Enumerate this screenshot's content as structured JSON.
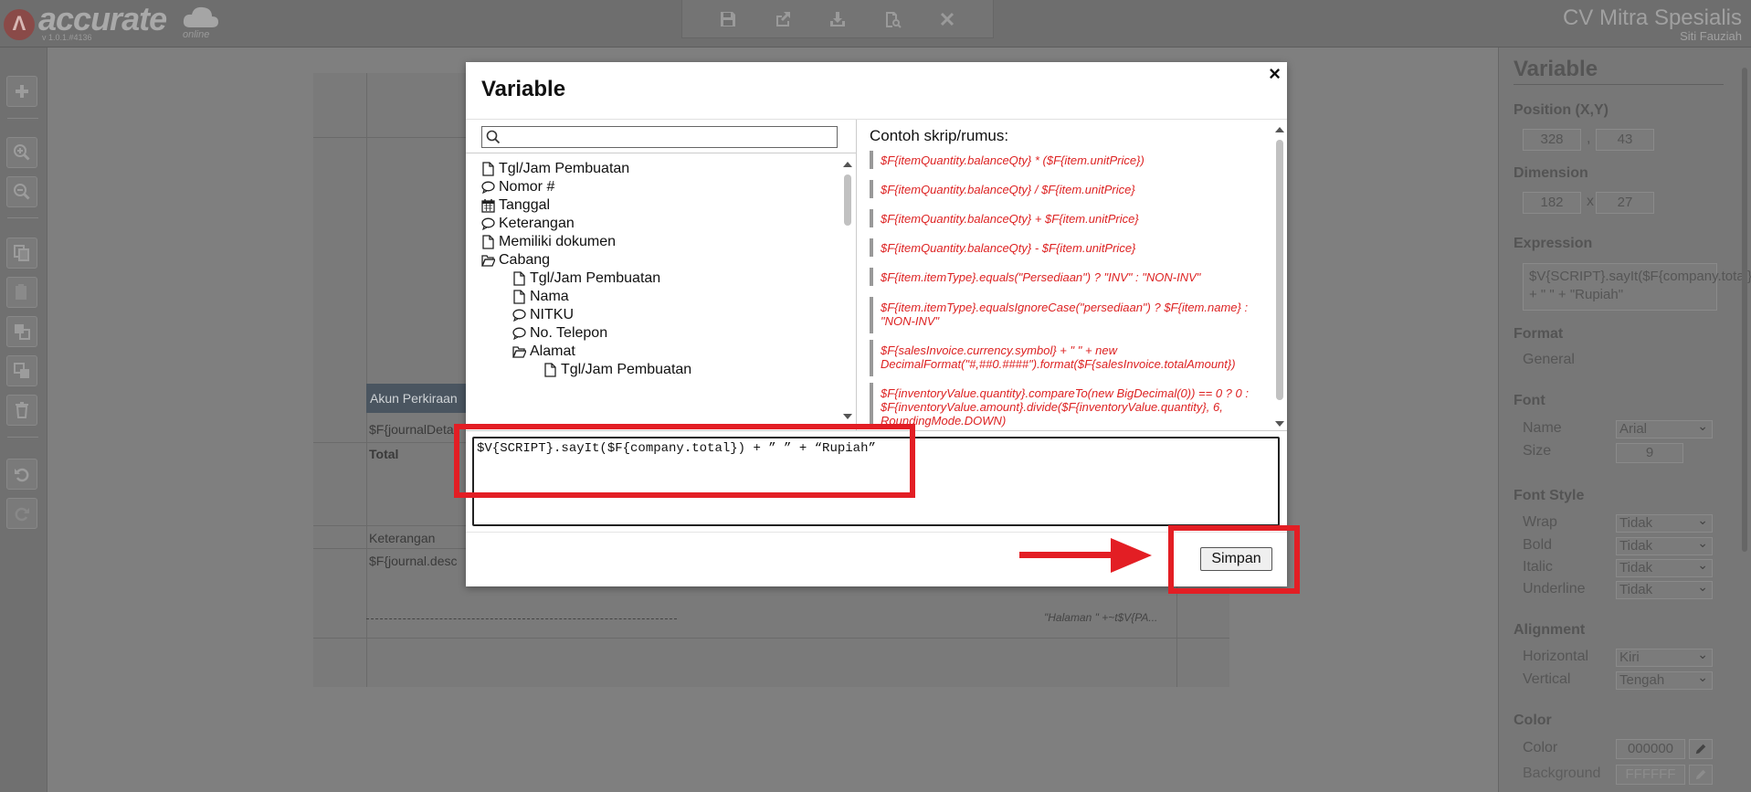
{
  "app": {
    "logo_text": "accurate",
    "logo_sub": "online",
    "version": "v 1.0.1.#4136",
    "company": "CV Mitra Spesialis",
    "user": "Siti Fauziah"
  },
  "toolbar": {
    "icons": [
      "save-icon",
      "export-icon",
      "download-icon",
      "preview-icon",
      "close-icon"
    ]
  },
  "sidebar_left": {
    "icons": [
      "add-icon",
      "zoom-in-icon",
      "zoom-out-icon",
      "copy-icon",
      "paste-icon",
      "bring-front-icon",
      "send-back-icon",
      "delete-icon",
      "undo-icon",
      "redo-icon"
    ]
  },
  "canvas": {
    "header_cell": "Akun Perkiraan",
    "field_detail": "$F{journalDeta",
    "total_label": "Total",
    "keterangan_label": "Keterangan",
    "field_desc": "$F{journal.desc",
    "page_text": "\"Halaman \" +~t$V{PA..."
  },
  "modal": {
    "title": "Variable",
    "close_label": "×",
    "search": {
      "value": "",
      "placeholder": ""
    },
    "tree": [
      {
        "label": "Tgl/Jam Pembuatan",
        "icon": "document-icon"
      },
      {
        "label": "Nomor #",
        "icon": "comment-icon"
      },
      {
        "label": "Tanggal",
        "icon": "calendar-icon"
      },
      {
        "label": "Keterangan",
        "icon": "comment-icon"
      },
      {
        "label": "Memiliki dokumen",
        "icon": "document-icon"
      },
      {
        "label": "Cabang",
        "icon": "folder-open-icon"
      },
      {
        "label": "Tgl/Jam Pembuatan",
        "icon": "document-icon"
      },
      {
        "label": "Nama",
        "icon": "document-icon"
      },
      {
        "label": "NITKU",
        "icon": "comment-icon"
      },
      {
        "label": "No. Telepon",
        "icon": "comment-icon"
      },
      {
        "label": "Alamat",
        "icon": "folder-open-icon"
      },
      {
        "label": "Tgl/Jam Pembuatan",
        "icon": "document-icon"
      }
    ],
    "examples_title": "Contoh skrip/rumus:",
    "examples": [
      "$F{itemQuantity.balanceQty} * ($F{item.unitPrice})",
      "$F{itemQuantity.balanceQty} / $F{item.unitPrice}",
      "$F{itemQuantity.balanceQty} + $F{item.unitPrice}",
      "$F{itemQuantity.balanceQty} - $F{item.unitPrice}",
      "$F{item.itemType}.equals(\"Persediaan\") ? \"INV\" : \"NON-INV\"",
      "$F{item.itemType}.equalsIgnoreCase(\"persediaan\") ? $F{item.name} : \"NON-INV\"",
      "$F{salesInvoice.currency.symbol} + \" \" + new DecimalFormat(\"#,##0.####\").format($F{salesInvoice.totalAmount})",
      "$F{inventoryValue.quantity}.compareTo(new BigDecimal(0)) == 0 ? 0 : $F{inventoryValue.amount}.divide($F{inventoryValue.quantity}, 6, RoundingMode.DOWN)"
    ],
    "expression": "$V{SCRIPT}.sayIt($F{company.total}) + ” ” + “Rupiah”",
    "save_label": "Simpan"
  },
  "panel": {
    "title": "Variable",
    "position_label": "Position (X,Y)",
    "pos_x": "328",
    "pos_sep": ",",
    "pos_y": "43",
    "dimension_label": "Dimension",
    "dim_w": "182",
    "dim_sep": "x",
    "dim_h": "27",
    "expression_label": "Expression",
    "expression_value": "$V{SCRIPT}.sayIt($F{company.total}) + \" \" + \"Rupiah\"",
    "format_label": "Format",
    "format_value": "General",
    "font_label": "Font",
    "font_name_label": "Name",
    "font_name_value": "Arial",
    "font_size_label": "Size",
    "font_size_value": "9",
    "font_style_label": "Font Style",
    "wrap_label": "Wrap",
    "wrap_value": "Tidak",
    "bold_label": "Bold",
    "bold_value": "Tidak",
    "italic_label": "Italic",
    "italic_value": "Tidak",
    "underline_label": "Underline",
    "underline_value": "Tidak",
    "alignment_label": "Alignment",
    "horizontal_label": "Horizontal",
    "horizontal_value": "Kiri",
    "vertical_label": "Vertical",
    "vertical_value": "Tengah",
    "color_label": "Color",
    "color_sub_label": "Color",
    "color_value": "000000",
    "background_label": "Background",
    "background_value": "FFFFFF"
  },
  "colors": {
    "highlight": "#e31e24",
    "example_text": "#dd2222",
    "overlay": "#7f7f7f"
  }
}
